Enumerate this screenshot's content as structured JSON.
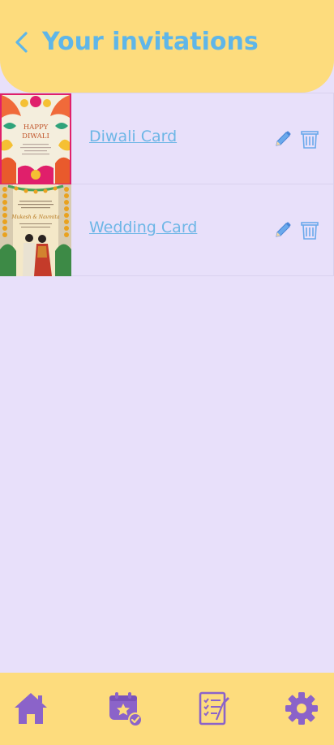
{
  "header": {
    "title": "Your invitations",
    "back_icon": "chevron-left-icon"
  },
  "invitations": [
    {
      "title": "Diwali Card",
      "thumb": {
        "line1": "HAPPY",
        "line2": "DIWALI"
      },
      "edit_icon": "pencil-icon",
      "delete_icon": "trash-icon"
    },
    {
      "title": "Wedding Card",
      "thumb": {
        "names": "Mukesh & Navmita"
      },
      "edit_icon": "pencil-icon",
      "delete_icon": "trash-icon"
    }
  ],
  "bottom_nav": {
    "items": [
      "home-icon",
      "calendar-star-check-icon",
      "checklist-icon",
      "gear-icon"
    ]
  },
  "colors": {
    "header_bg": "#fddc7d",
    "page_bg": "#e8e0fa",
    "title_blue": "#5fb6e8",
    "nav_purple": "#8b63c9"
  }
}
